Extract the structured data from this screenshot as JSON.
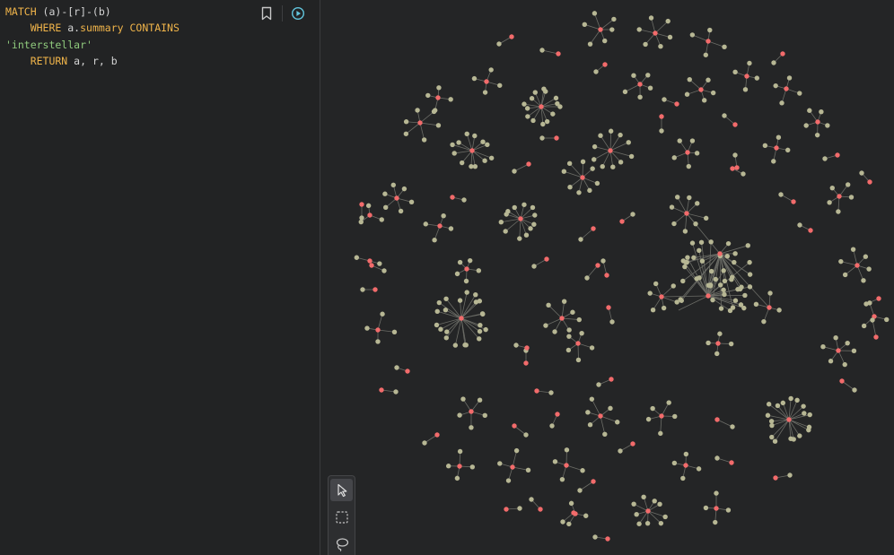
{
  "editor": {
    "lines": [
      [
        {
          "t": "MATCH",
          "c": "kw"
        },
        {
          "t": " (a)-[r]-(b)",
          "c": ""
        }
      ],
      [
        {
          "t": "    WHERE",
          "c": "kw"
        },
        {
          "t": " a.",
          "c": ""
        },
        {
          "t": "summary",
          "c": "prop"
        },
        {
          "t": " ",
          "c": ""
        },
        {
          "t": "CONTAINS",
          "c": "kw"
        }
      ],
      [
        {
          "t": "'interstellar'",
          "c": "str"
        }
      ],
      [
        {
          "t": "    RETURN",
          "c": "kw"
        },
        {
          "t": " a, r, b",
          "c": ""
        }
      ]
    ]
  },
  "toolbar": {
    "bookmark_icon": "bookmark-icon",
    "run_icon": "play-circle-icon"
  },
  "tools": {
    "items": [
      "pointer-icon",
      "box-select-icon",
      "lasso-icon"
    ],
    "active": "pointer-icon"
  },
  "colors": {
    "editor_bg": "#222324",
    "graph_bg": "#242526",
    "node_hub": "#f26b6b",
    "node_leaf": "#b7b794",
    "edge": "#6b6c66",
    "accent": "#62c6de"
  }
}
